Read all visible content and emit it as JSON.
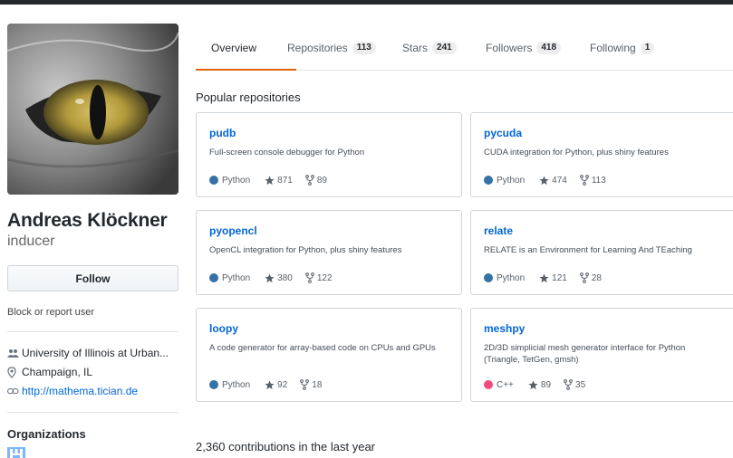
{
  "profile": {
    "full_name": "Andreas Klöckner",
    "username": "inducer",
    "follow_label": "Follow",
    "block_label": "Block or report user",
    "organization": "University of Illinois at Urban...",
    "location": "Champaign, IL",
    "website": "http://mathema.tician.de",
    "organizations_heading": "Organizations",
    "avatar_icon": "cat-eye-avatar"
  },
  "tabs": [
    {
      "label": "Overview",
      "count": null,
      "active": true
    },
    {
      "label": "Repositories",
      "count": "113",
      "active": false
    },
    {
      "label": "Stars",
      "count": "241",
      "active": false
    },
    {
      "label": "Followers",
      "count": "418",
      "active": false
    },
    {
      "label": "Following",
      "count": "1",
      "active": false
    }
  ],
  "popular": {
    "title": "Popular repositories",
    "repos": [
      {
        "name": "pudb",
        "description": "Full-screen console debugger for Python",
        "language": "Python",
        "language_color": "#3572A5",
        "stars": "871",
        "forks": "89"
      },
      {
        "name": "pycuda",
        "description": "CUDA integration for Python, plus shiny features",
        "language": "Python",
        "language_color": "#3572A5",
        "stars": "474",
        "forks": "113"
      },
      {
        "name": "pyopencl",
        "description": "OpenCL integration for Python, plus shiny features",
        "language": "Python",
        "language_color": "#3572A5",
        "stars": "380",
        "forks": "122"
      },
      {
        "name": "relate",
        "description": "RELATE is an Environment for Learning And TEaching",
        "language": "Python",
        "language_color": "#3572A5",
        "stars": "121",
        "forks": "28"
      },
      {
        "name": "loopy",
        "description": "A code generator for array-based code on CPUs and GPUs",
        "language": "Python",
        "language_color": "#3572A5",
        "stars": "92",
        "forks": "18"
      },
      {
        "name": "meshpy",
        "description": "2D/3D simplicial mesh generator interface for Python (Triangle, TetGen, gmsh)",
        "language": "C++",
        "language_color": "#f34b7d",
        "stars": "89",
        "forks": "35"
      }
    ]
  },
  "contributions": {
    "summary": "2,360 contributions in the last year"
  },
  "colors": {
    "accent_tab": "#e36209",
    "link": "#0366d6",
    "org_icon": "#79b8ff"
  }
}
